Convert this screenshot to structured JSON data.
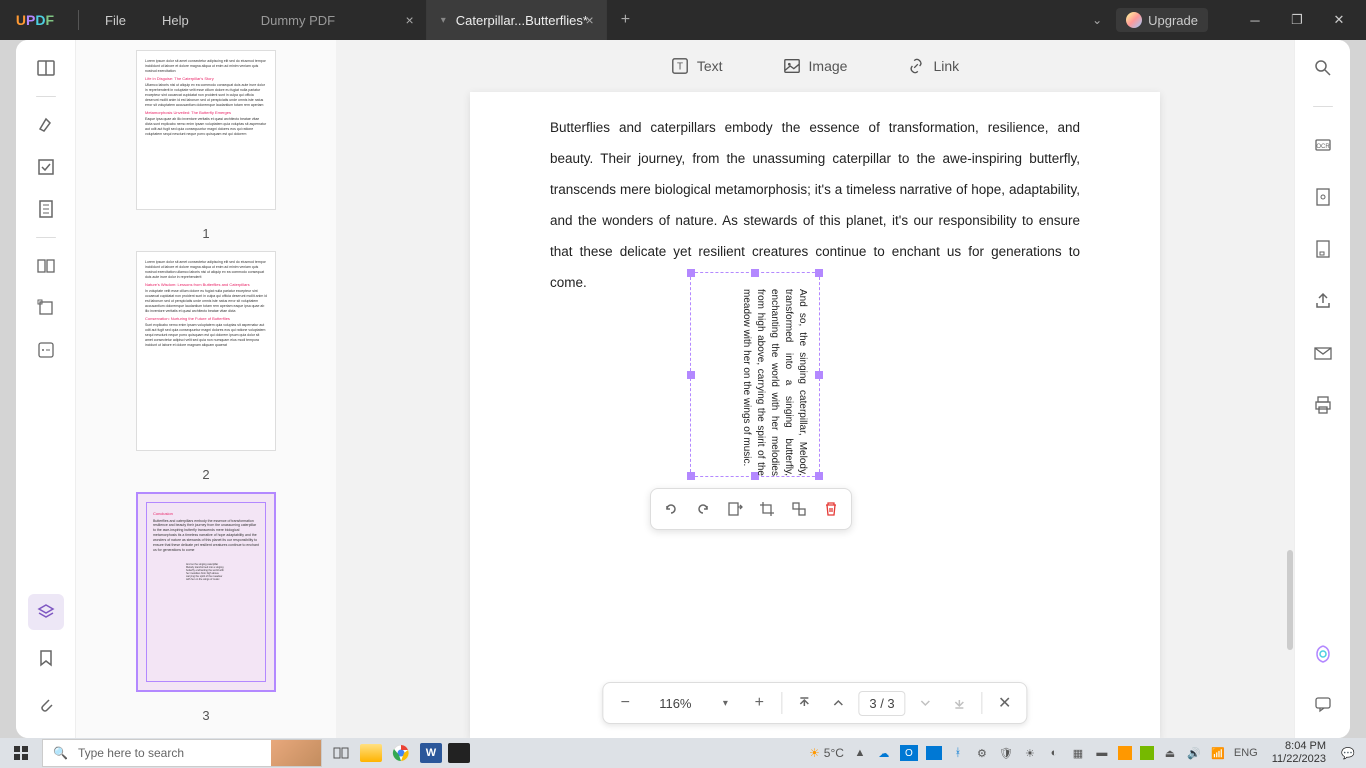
{
  "titlebar": {
    "logo_letters": [
      "U",
      "P",
      "D",
      "F"
    ],
    "menus": {
      "file": "File",
      "help": "Help"
    },
    "tabs": [
      {
        "label": "Dummy PDF",
        "active": false
      },
      {
        "label": "Caterpillar...Butterflies*",
        "active": true
      }
    ],
    "upgrade": "Upgrade"
  },
  "toolbar": {
    "text": "Text",
    "image": "Image",
    "link": "Link"
  },
  "page": {
    "body": "Butterflies and caterpillars embody the essence of transformation, resilience, and beauty. Their journey, from the unassuming caterpillar to the awe-inspiring butterfly, transcends mere biological metamorphosis; it's a timeless narrative of hope, adaptability, and the wonders of nature. As stewards of this planet, it's our responsibility to ensure that these delicate yet resilient creatures continue to enchant us for generations to come.",
    "rotated": "And so, the singing caterpillar, Melody, transformed into a singing butterfly, enchanting the world with her melodies from high above, carrying the spirit of the meadow with her on the wings of music."
  },
  "thumbs": {
    "labels": [
      "1",
      "2",
      "3"
    ]
  },
  "zoom": {
    "pct": "116%",
    "page": "3 / 3"
  },
  "taskbar": {
    "search_placeholder": "Type here to search",
    "weather": "5°C",
    "lang": "ENG",
    "time": "8:04 PM",
    "date": "11/22/2023"
  },
  "thumb1_heads": [
    "Life in Disguise: The Caterpillar's Story",
    "Metamorphosis Unveiled: The Butterfly Emerges"
  ],
  "thumb2_heads": [
    "Nature's Wisdom: Lessons from Butterflies and Caterpillars",
    "Conservation: Nurturing the Future of Butterflies"
  ]
}
